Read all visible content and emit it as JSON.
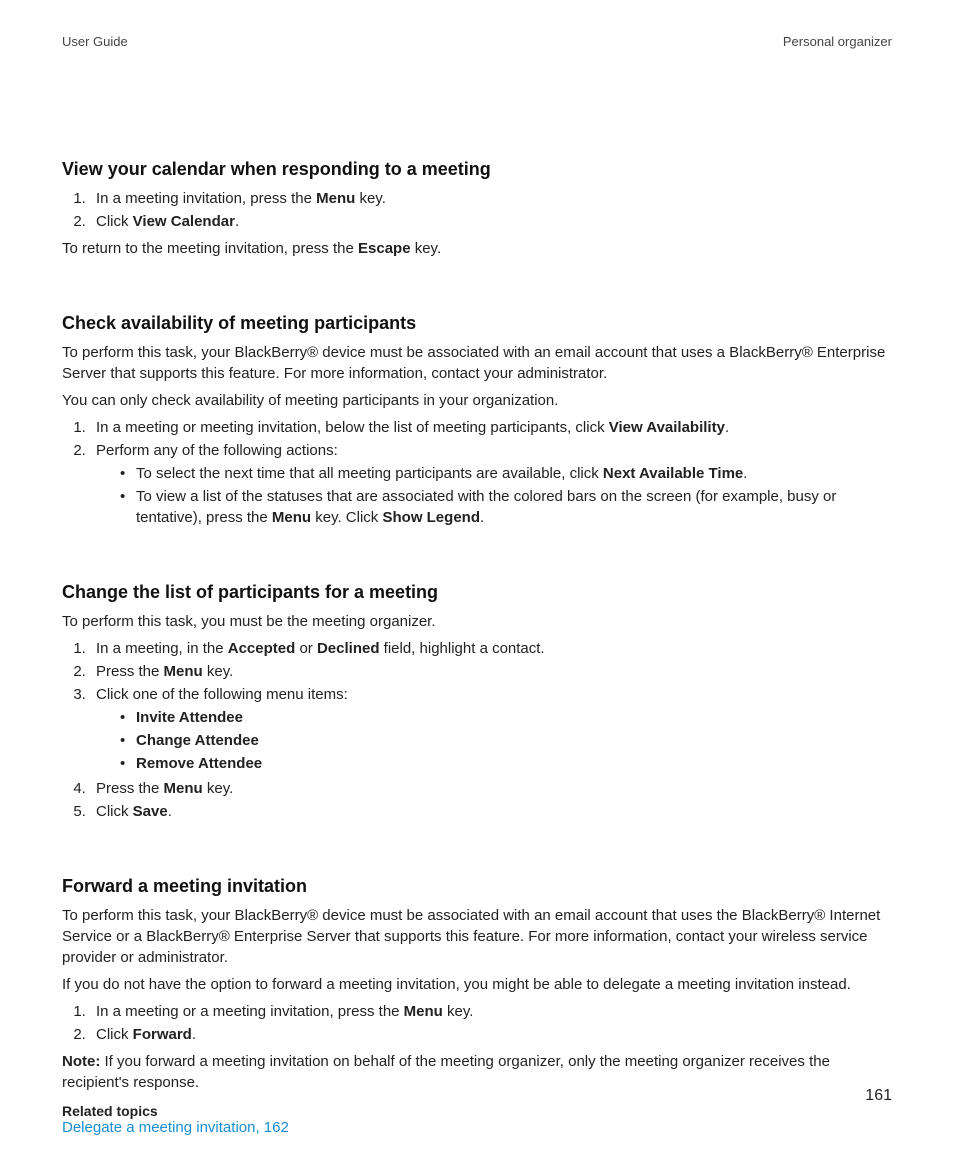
{
  "header": {
    "left": "User Guide",
    "right": "Personal organizer"
  },
  "page_number": "161",
  "s1": {
    "heading": "View your calendar when responding to a meeting",
    "o1a": "In a meeting invitation, press the ",
    "o1b": "Menu",
    "o1c": " key.",
    "o2a": "Click ",
    "o2b": "View Calendar",
    "o2c": ".",
    "p1a": "To return to the meeting invitation, press the ",
    "p1b": "Escape",
    "p1c": " key."
  },
  "s2": {
    "heading": "Check availability of meeting participants",
    "p1": "To perform this task, your BlackBerry® device must be associated with an email account that uses a BlackBerry® Enterprise Server that supports this feature. For more information, contact your administrator.",
    "p2": "You can only check availability of meeting participants in your organization.",
    "o1a": "In a meeting or meeting invitation, below the list of meeting participants, click ",
    "o1b": "View Availability",
    "o1c": ".",
    "o2": "Perform any of the following actions:",
    "b1a": "To select the next time that all meeting participants are available, click ",
    "b1b": "Next Available Time",
    "b1c": ".",
    "b2a": "To view a list of the statuses that are associated with the colored bars on the screen (for example, busy or tentative), press the ",
    "b2b": "Menu",
    "b2c": " key. Click ",
    "b2d": "Show Legend",
    "b2e": "."
  },
  "s3": {
    "heading": "Change the list of participants for a meeting",
    "p1": "To perform this task, you must be the meeting organizer.",
    "o1a": "In a meeting, in the ",
    "o1b": "Accepted",
    "o1c": " or ",
    "o1d": "Declined",
    "o1e": " field, highlight a contact.",
    "o2a": "Press the ",
    "o2b": "Menu",
    "o2c": " key.",
    "o3": "Click one of the following menu items:",
    "b1": "Invite Attendee",
    "b2": "Change Attendee",
    "b3": "Remove Attendee",
    "o4a": "Press the ",
    "o4b": "Menu",
    "o4c": " key.",
    "o5a": "Click ",
    "o5b": "Save",
    "o5c": "."
  },
  "s4": {
    "heading": "Forward a meeting invitation",
    "p1": "To perform this task, your BlackBerry® device must be associated with an email account that uses the BlackBerry® Internet Service or a BlackBerry® Enterprise Server that supports this feature. For more information, contact your wireless service provider or administrator.",
    "p2": "If you do not have the option to forward a meeting invitation, you might be able to delegate a meeting invitation instead.",
    "o1a": "In a meeting or a meeting invitation, press the ",
    "o1b": "Menu",
    "o1c": " key.",
    "o2a": "Click ",
    "o2b": "Forward",
    "o2c": ".",
    "noteLabel": "Note:",
    "note": "  If you forward a meeting invitation on behalf of the meeting organizer, only the meeting organizer receives the recipient's response.",
    "related_heading": "Related topics",
    "related_link": "Delegate a meeting invitation, 162"
  }
}
